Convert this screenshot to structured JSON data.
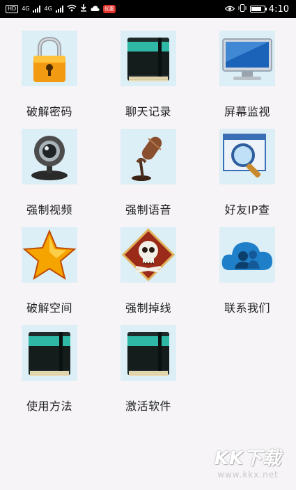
{
  "status_bar": {
    "hd_badge": "HD",
    "network_1": "4G",
    "network_2": "4G",
    "app_badge": "优惠",
    "time": "4:10"
  },
  "grid": {
    "items": [
      {
        "label": "破解密码",
        "icon": "padlock-icon"
      },
      {
        "label": "聊天记录",
        "icon": "notebook-icon"
      },
      {
        "label": "屏幕监视",
        "icon": "monitor-icon"
      },
      {
        "label": "强制视频",
        "icon": "webcam-icon"
      },
      {
        "label": "强制语音",
        "icon": "microphone-icon"
      },
      {
        "label": "好友IP查",
        "icon": "magnifier-window-icon"
      },
      {
        "label": "破解空间",
        "icon": "star-icon"
      },
      {
        "label": "强制掉线",
        "icon": "skull-icon"
      },
      {
        "label": "联系我们",
        "icon": "contacts-cloud-icon"
      },
      {
        "label": "使用方法",
        "icon": "notebook-icon"
      },
      {
        "label": "激活软件",
        "icon": "notebook-icon"
      }
    ]
  },
  "watermark": {
    "logo": "KK下载",
    "url": "www.kkx.net"
  },
  "colors": {
    "background": "#f6f4f7",
    "icon_tile": "#dceef6",
    "status_bar": "#000000"
  }
}
